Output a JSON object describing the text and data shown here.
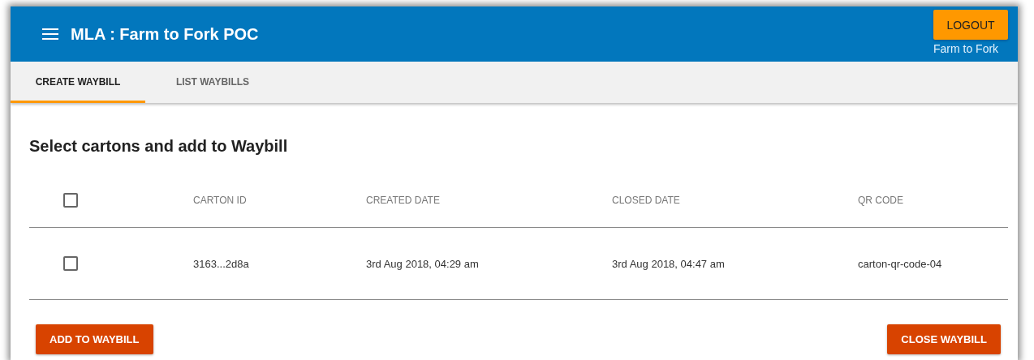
{
  "app_bar": {
    "title": "MLA : Farm to Fork POC",
    "logout_button": "LOGOUT",
    "subtitle": "Farm to Fork"
  },
  "tabs": [
    {
      "label": "CREATE WAYBILL",
      "selected": true
    },
    {
      "label": "LIST WAYBILLS",
      "selected": false
    }
  ],
  "heading": "Select cartons and add to Waybill",
  "table": {
    "select_all_checked": false,
    "columns": [
      "CARTON ID",
      "CREATED DATE",
      "CLOSED DATE",
      "QR CODE"
    ],
    "rows": [
      {
        "checked": false,
        "cells": [
          "3163...2d8a",
          "3rd Aug 2018, 04:29 am",
          "3rd Aug 2018, 04:47 am",
          "carton-qr-code-04"
        ]
      }
    ]
  },
  "buttons": [
    {
      "label": "ADD TO WAYBILL"
    },
    {
      "label": "CLOSE WAYBILL"
    }
  ]
}
